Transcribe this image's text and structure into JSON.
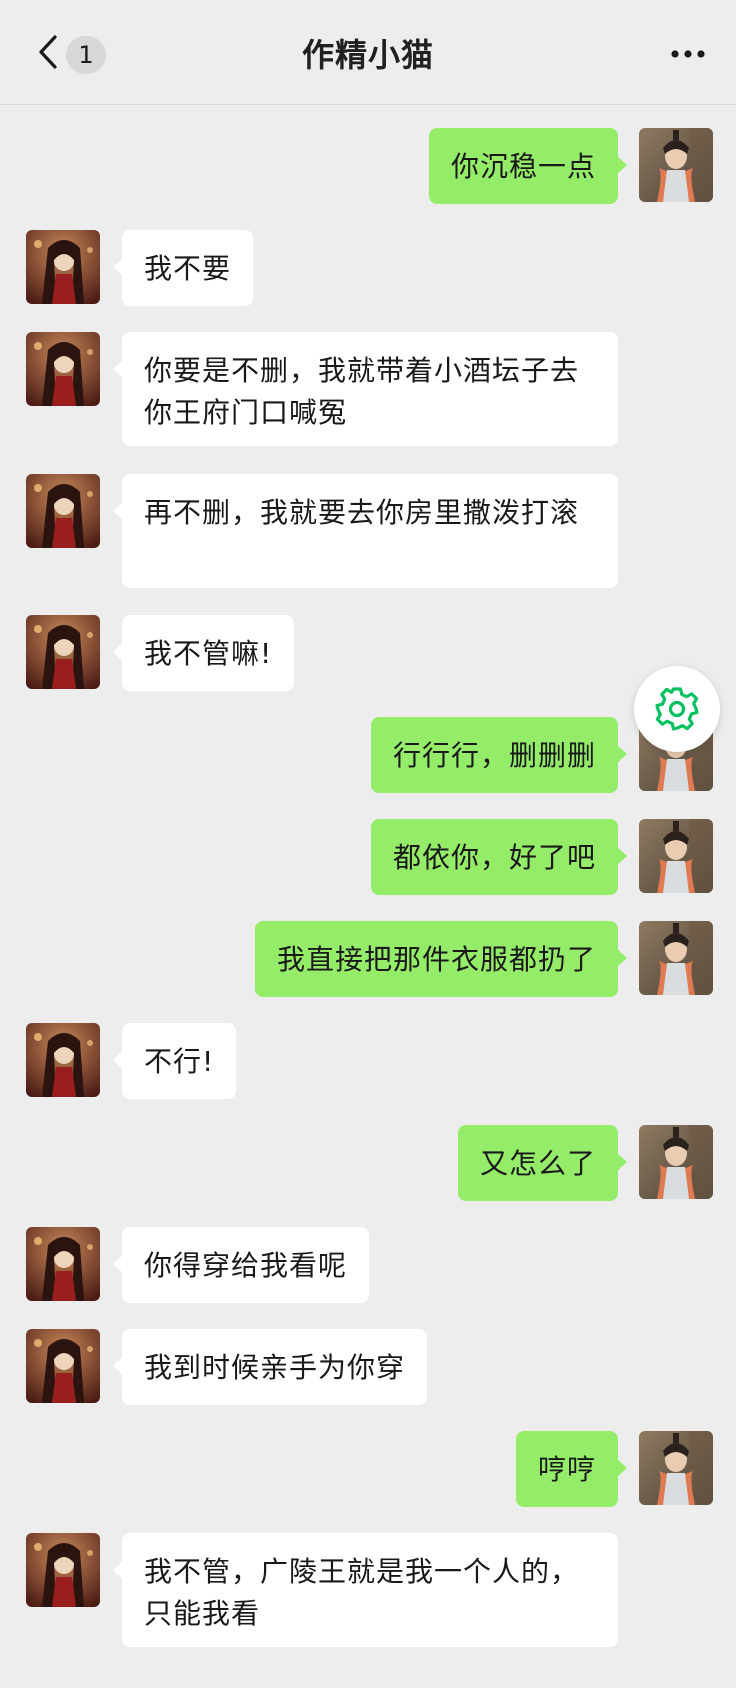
{
  "header": {
    "title": "作精小猫",
    "unread_count": "1"
  },
  "colors": {
    "background": "#ededed",
    "bubble_self": "#95ec69",
    "bubble_other": "#ffffff",
    "gear_accent": "#07c160"
  },
  "messages": [
    {
      "side": "right",
      "text": "你沉稳一点"
    },
    {
      "side": "left",
      "text": "我不要"
    },
    {
      "side": "left",
      "text": "你要是不删，我就带着小酒坛子去你王府门口喊冤"
    },
    {
      "side": "left",
      "text": "再不删，我就要去你房里撒泼打滚"
    },
    {
      "side": "left",
      "text": "我不管嘛!"
    },
    {
      "side": "right",
      "text": "行行行，删删删"
    },
    {
      "side": "right",
      "text": "都依你，好了吧"
    },
    {
      "side": "right",
      "text": "我直接把那件衣服都扔了"
    },
    {
      "side": "left",
      "text": "不行!"
    },
    {
      "side": "right",
      "text": "又怎么了"
    },
    {
      "side": "left",
      "text": "你得穿给我看呢"
    },
    {
      "side": "left",
      "text": "我到时候亲手为你穿"
    },
    {
      "side": "right",
      "text": "哼哼"
    },
    {
      "side": "left",
      "text": "我不管，广陵王就是我一个人的，只能我看"
    }
  ],
  "icons": {
    "back": "chevron-left-icon",
    "more": "more-dots-icon",
    "floating": "gear-icon"
  }
}
